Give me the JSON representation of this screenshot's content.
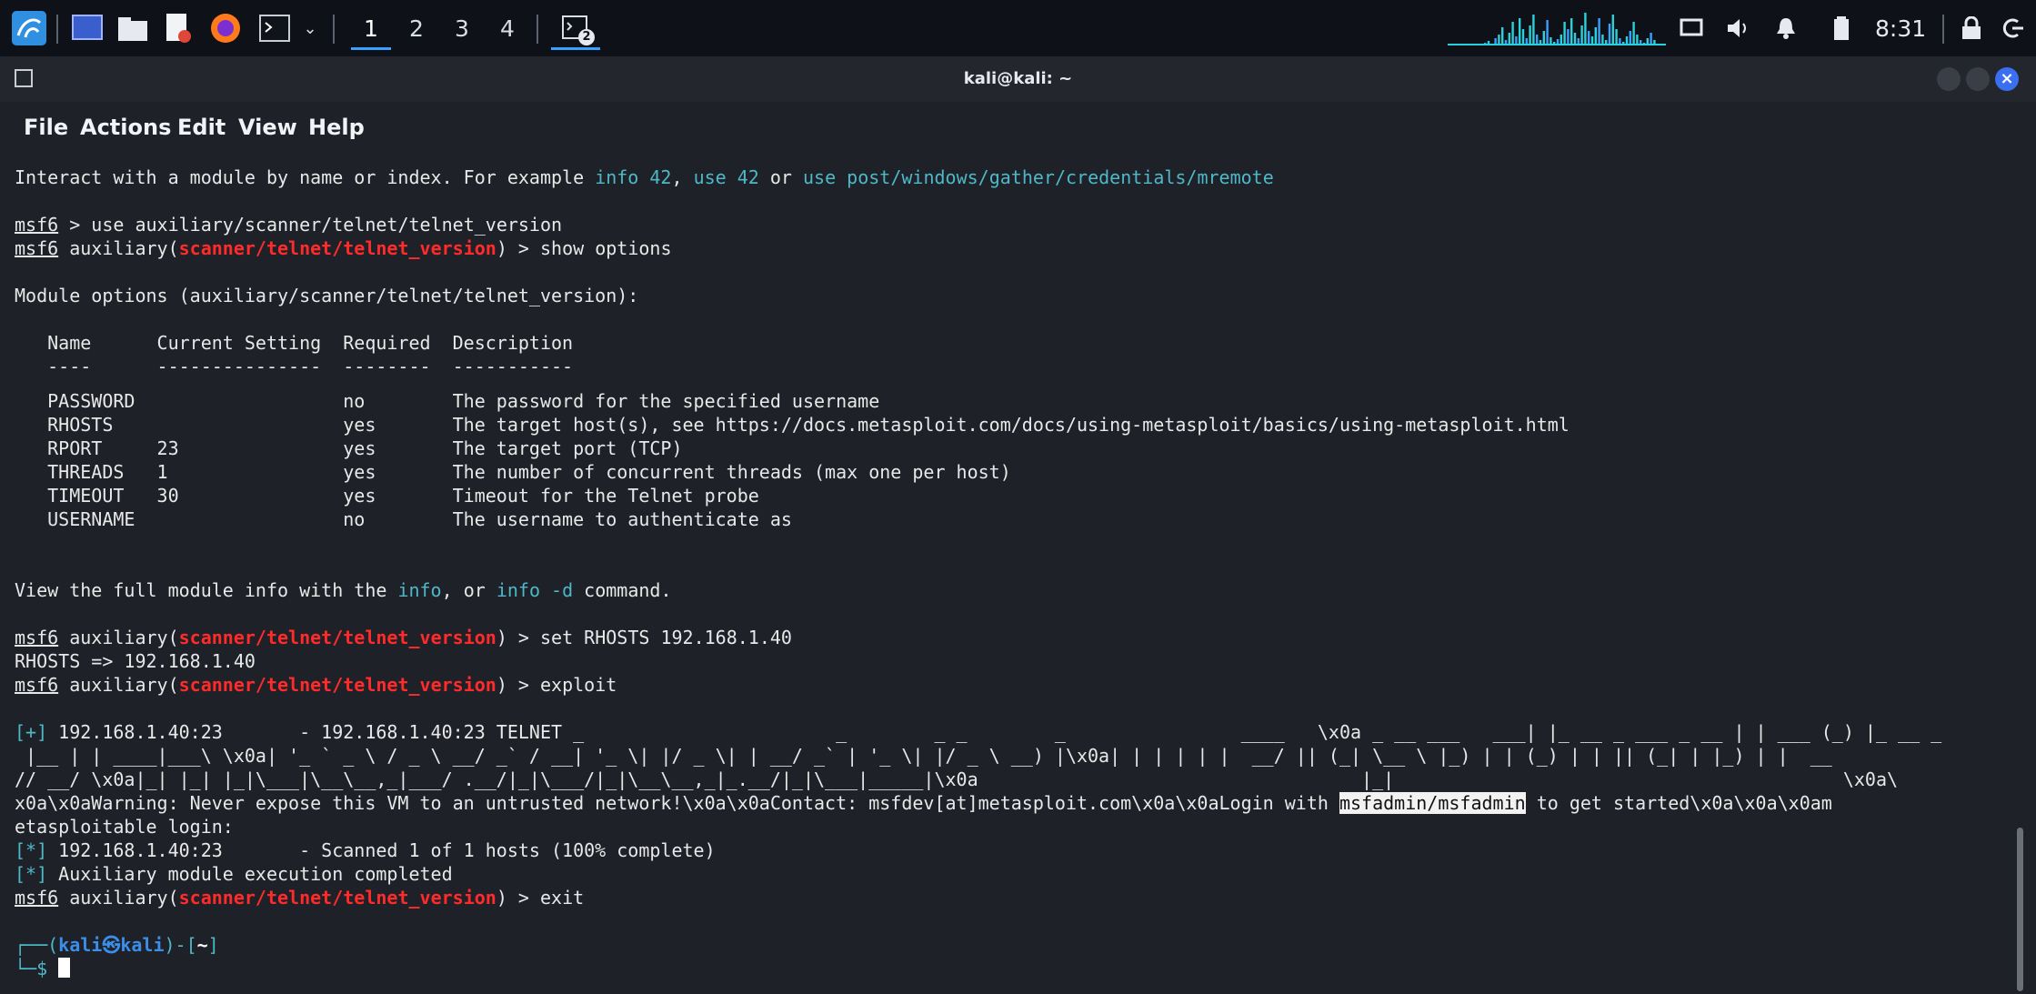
{
  "panel": {
    "workspaces": [
      "1",
      "2",
      "3",
      "4"
    ],
    "active_workspace": "1",
    "taskbar_badge": "2",
    "clock": "8:31",
    "launchers": [
      "kali-menu-icon",
      "show-desktop-icon",
      "file-manager-icon",
      "text-editor-icon",
      "firefox-icon",
      "terminal-icon"
    ],
    "tray": [
      "network-graph",
      "network-icon",
      "volume-icon",
      "notifications-icon",
      "battery-icon",
      "lock-icon",
      "logout-icon"
    ],
    "accent": "#3aa0ff"
  },
  "window": {
    "title": "kali@kali: ~",
    "menu": [
      "File",
      "Actions",
      "Edit",
      "View",
      "Help"
    ]
  },
  "colors": {
    "red_module": "#ff2b2b",
    "cyan": "#4fb8c8",
    "prompt_blue": "#3b8eea",
    "background": "#1e2128"
  },
  "terminal": {
    "l1_a": "Interact with a module by name or index. For example ",
    "l1_b": "info 42",
    "l1_c": ", ",
    "l1_d": "use 42",
    "l1_e": " or ",
    "l1_f": "use post/windows/gather/credentials/mremote",
    "msf": "msf6",
    "cmd_use": " > use auxiliary/scanner/telnet/telnet_version",
    "aux_open": " auxiliary(",
    "module": "scanner/telnet/telnet_version",
    "cmd_show": ") > show options",
    "mod_opts": "Module options (auxiliary/scanner/telnet/telnet_version):",
    "hdr": "   Name      Current Setting  Required  Description",
    "sep": "   ----      ---------------  --------  -----------",
    "options": [
      "   PASSWORD                   no        The password for the specified username",
      "   RHOSTS                     yes       The target host(s), see https://docs.metasploit.com/docs/using-metasploit/basics/using-metasploit.html",
      "   RPORT     23               yes       The target port (TCP)",
      "   THREADS   1                yes       The number of concurrent threads (max one per host)",
      "   TIMEOUT   30               yes       Timeout for the Telnet probe",
      "   USERNAME                   no        The username to authenticate as"
    ],
    "v_a": "View the full module info with the ",
    "v_b": "info",
    "v_c": ", or ",
    "v_d": "info -d",
    "v_e": " command.",
    "cmd_set": ") > set RHOSTS 192.168.1.40",
    "rhosts_out": "RHOSTS => 192.168.1.40",
    "cmd_exploit": ") > exploit",
    "plus": "[+]",
    "star": "[*]",
    "res1": " 192.168.1.40:23       - 192.168.1.40:23 TELNET _                       _        _ _        _                ____   \\x0a _ __ ___   ___| |_ __ _ ___ _ __ | | ___ (_) |_ __ _",
    "res2": " |__ | | ____|___\\ \\x0a| '_ ` _ \\ / _ \\ __/ _` / __| '_ \\| |/ _ \\| | __/ _` | '_ \\| |/ _ \\ __) |\\x0a| | | | | |  __/ || (_| \\__ \\ |_) | | (_) | | || (_| | |_) | |  __",
    "res3": "// __/ \\x0a|_| |_| |_|\\___|\\__\\__,_|___/ .__/|_|\\___/|_|\\__\\__,_|_.__/|_|\\___|_____|\\x0a                                   |_|                                         \\x0a\\",
    "res4_a": "x0a\\x0aWarning: Never expose this VM to an untrusted network!\\x0a\\x0aContact: msfdev[at]metasploit.com\\x0a\\x0aLogin with ",
    "res4_hl": "msfadmin/msfadmin",
    "res4_b": " to get started\\x0a\\x0a\\x0am",
    "res5": "etasploitable login:",
    "res6": " 192.168.1.40:23       - Scanned 1 of 1 hosts (100% complete)",
    "res7": " Auxiliary module execution completed",
    "cmd_exit": ") > exit",
    "prompt1_a": "┌──(",
    "prompt1_user": "kali㉿kali",
    "prompt1_b": ")-[",
    "prompt1_dir": "~",
    "prompt1_c": "]",
    "prompt2": "└─$ "
  }
}
